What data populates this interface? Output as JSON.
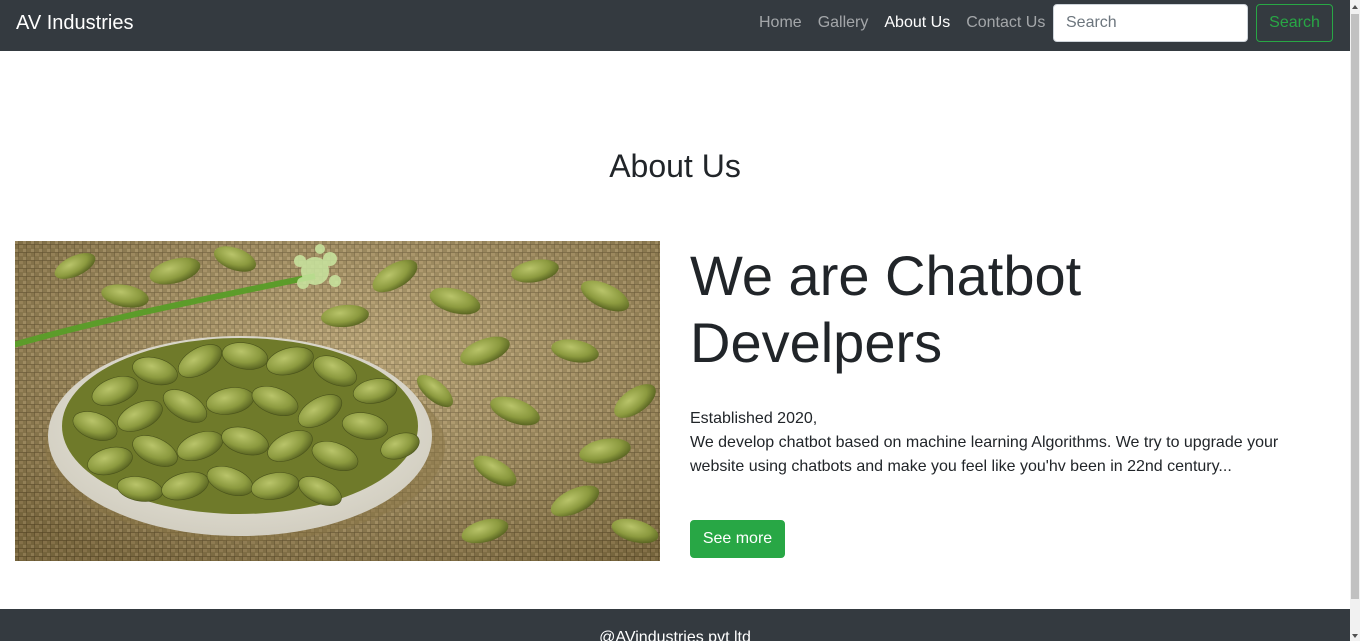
{
  "navbar": {
    "brand": "AV Industries",
    "links": [
      {
        "label": "Home",
        "active": false
      },
      {
        "label": "Gallery",
        "active": false
      },
      {
        "label": "About Us",
        "active": true
      },
      {
        "label": "Contact Us",
        "active": false
      }
    ],
    "search": {
      "placeholder": "Search",
      "value": "",
      "button_label": "Search"
    },
    "colors": {
      "background": "#343a40",
      "accent": "#28a745"
    }
  },
  "main": {
    "heading": "About Us",
    "display_heading": "We are Chatbot Develpers",
    "established": "Established 2020,",
    "description": "We develop chatbot based on machine learning Algorithms. We try to upgrade your website using chatbots and make you feel like you'hv been in 22nd century...",
    "cta_label": "See more",
    "image_subject": "cardamom-pods-in-white-bowl-on-burlap"
  },
  "footer": {
    "text": "@AVindustries pvt ltd"
  },
  "icons": {
    "scroll_up": "chevron-up-icon",
    "scroll_down": "chevron-down-icon"
  }
}
